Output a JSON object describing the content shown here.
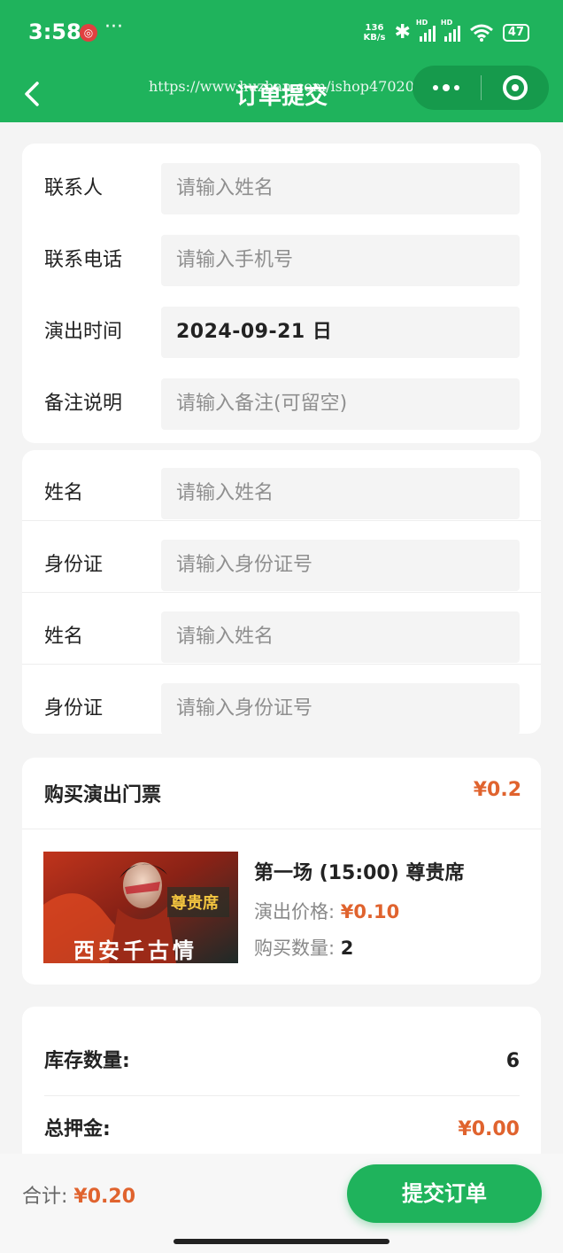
{
  "status_bar": {
    "time": "3:58",
    "net_speed_value": "136",
    "net_speed_unit": "KB/s",
    "battery": "47",
    "hd1": "HD",
    "hd2": "HD"
  },
  "nav": {
    "title": "订单提交",
    "watermark": "https://www.huzhan.com/ishop47020"
  },
  "contact_form": {
    "fields": [
      {
        "label": "联系人",
        "placeholder": "请输入姓名",
        "value": ""
      },
      {
        "label": "联系电话",
        "placeholder": "请输入手机号",
        "value": ""
      },
      {
        "label": "演出时间",
        "placeholder": "",
        "value": "2024-09-21 日"
      },
      {
        "label": "备注说明",
        "placeholder": "请输入备注(可留空)",
        "value": ""
      }
    ]
  },
  "visitor_form": {
    "fields": [
      {
        "label": "姓名",
        "placeholder": "请输入姓名"
      },
      {
        "label": "身份证",
        "placeholder": "请输入身份证号"
      },
      {
        "label": "姓名",
        "placeholder": "请输入姓名"
      },
      {
        "label": "身份证",
        "placeholder": "请输入身份证号"
      }
    ]
  },
  "ticket": {
    "heading": "购买演出门票",
    "total": "¥0.2",
    "poster_badge": "尊贵席",
    "poster_title": "西安千古情",
    "name": "第一场 (15:00) 尊贵席",
    "price_label": "演出价格:",
    "price": "¥0.10",
    "qty_label": "购买数量:",
    "qty": "2"
  },
  "summary": {
    "stock_label": "库存数量:",
    "stock_value": "6",
    "deposit_label": "总押金:",
    "deposit_value": "¥0.00"
  },
  "footer": {
    "total_label": "合计:",
    "total_value": "¥0.20",
    "submit_label": "提交订单"
  },
  "colors": {
    "brand_green": "#1fb35c",
    "price_orange": "#e0632e"
  }
}
